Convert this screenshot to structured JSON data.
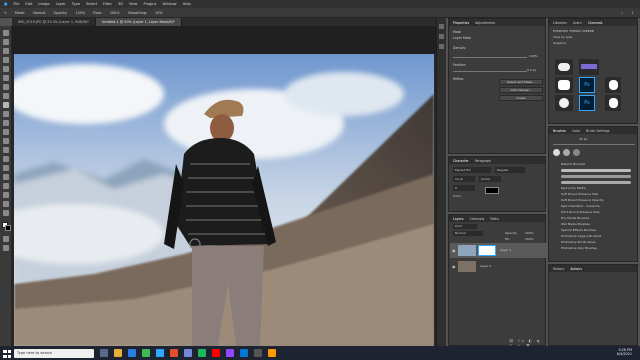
{
  "menu": [
    "File",
    "Edit",
    "Image",
    "Layer",
    "Type",
    "Select",
    "Filter",
    "3D",
    "View",
    "Plugins",
    "Window",
    "Help"
  ],
  "options_bar": [
    "Mode:",
    "Normal",
    "Opacity:",
    "100%",
    "Flow:",
    "100%",
    "Smoothing:",
    "10%"
  ],
  "doc_tabs": [
    {
      "label": "IMG_0019.JPG @ 33.3% (Layer 1, RGB/8)*",
      "active": false
    },
    {
      "label": "Untitled-1 @ 50% (Layer 1, Layer Mask/8)*",
      "active": true
    }
  ],
  "properties": {
    "tabs": [
      "Properties",
      "Adjustments"
    ],
    "title": "Mask",
    "rows": [
      "Layer Mask",
      "Density:",
      "Feather:",
      "Refine:"
    ],
    "density_value": "100%",
    "feather_value": "0.0 px",
    "buttons": [
      "Select and Mask...",
      "Color Range...",
      "Invert"
    ]
  },
  "libraries": {
    "tabs": [
      "Libraries",
      "Learn",
      "Channels"
    ],
    "title": "EVERYDAY THINGS SUPERB",
    "view_label": "View by type",
    "graphics_label": "Graphics"
  },
  "brushes_panel": {
    "tabs": [
      "Brushes",
      "Color",
      "Brush Settings"
    ],
    "size_value": "25 px",
    "groups": [
      "Natural Brushes",
      "Kyle's Dry Media",
      "Soft Round Pressure Size",
      "Soft Round Pressure Opacity",
      "Kyle's Paintbox - Gouache",
      "Hard Round Pressure Size",
      "Dry Media Brushes",
      "Wet Media Brushes",
      "Special Effects Brushes",
      "Photoshop Legacy Brushes",
      "Photoshop Pro Brushes",
      "Photoshop Inky Brushes"
    ]
  },
  "character": {
    "tabs": [
      "Character",
      "Paragraph"
    ],
    "font": "Myriad Pro",
    "style": "Regular",
    "size": "12 pt",
    "leading": "(Auto)",
    "tracking": "0",
    "color_label": "Color:"
  },
  "layers": {
    "tabs": [
      "Layers",
      "Channels",
      "Paths"
    ],
    "kind": "Kind",
    "blend": "Normal",
    "opacity_label": "Opacity:",
    "opacity_value": "100%",
    "fill_label": "Fill:",
    "fill_value": "100%",
    "items": [
      {
        "name": "Layer 1",
        "selected": true
      },
      {
        "name": "Layer 0",
        "selected": false
      }
    ]
  },
  "history": {
    "tabs": [
      "History",
      "Actions"
    ]
  },
  "taskbar": {
    "search_placeholder": "Type here to search",
    "time": "3:28 PM",
    "date": "6/4/2021"
  },
  "colors": {
    "accent": "#31a8ff",
    "sky_top": "#7da3d4",
    "mountain": "#5c5550"
  }
}
